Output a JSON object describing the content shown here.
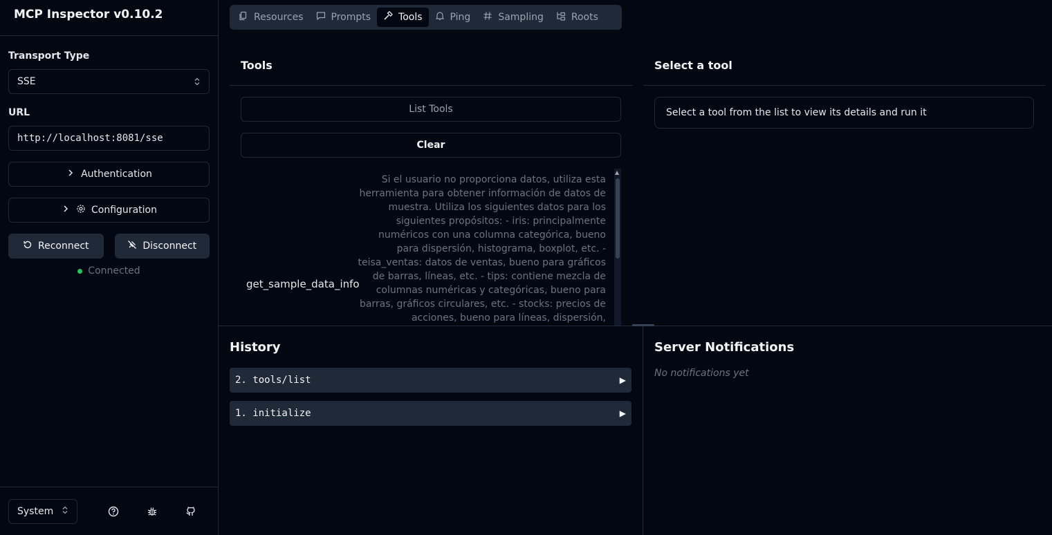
{
  "app": {
    "title": "MCP Inspector v0.10.2"
  },
  "sidebar": {
    "transport_label": "Transport Type",
    "transport_value": "SSE",
    "url_label": "URL",
    "url_value": "http://localhost:8081/sse",
    "auth_label": "Authentication",
    "config_label": "Configuration",
    "reconnect_label": "Reconnect",
    "disconnect_label": "Disconnect",
    "status_text": "Connected",
    "status_color": "#22c55e",
    "theme_value": "System"
  },
  "tabs": [
    {
      "label": "Resources",
      "icon": "files-icon"
    },
    {
      "label": "Prompts",
      "icon": "message-icon"
    },
    {
      "label": "Tools",
      "icon": "hammer-icon",
      "active": true
    },
    {
      "label": "Ping",
      "icon": "bell-icon"
    },
    {
      "label": "Sampling",
      "icon": "hash-icon"
    },
    {
      "label": "Roots",
      "icon": "folder-tree-icon"
    }
  ],
  "tools": {
    "title": "Tools",
    "list_button": "List Tools",
    "clear_button": "Clear",
    "items": [
      {
        "name": "get_sample_data_info",
        "description": "Si el usuario no proporciona datos, utiliza esta herramienta para obtener información de datos de muestra. Utiliza los siguientes datos para los siguientes propósitos: - iris: principalmente numéricos con una columna categórica, bueno para dispersión, histograma, boxplot, etc. - teisa_ventas: datos de ventas, bueno para gráficos de barras, líneas, etc. - tips: contiene mezcla de columnas numéricas y categóricas, bueno para barras, gráficos circulares, etc. - stocks: precios de acciones, bueno para líneas, dispersión, generalmente cosas que cambian con el tiempo - gapminder: datos demográficos,"
      }
    ]
  },
  "detail": {
    "title": "Select a tool",
    "placeholder": "Select a tool from the list to view its details and run it"
  },
  "history": {
    "title": "History",
    "items": [
      "2. tools/list",
      "1. initialize"
    ]
  },
  "notifications": {
    "title": "Server Notifications",
    "empty_text": "No notifications yet"
  }
}
